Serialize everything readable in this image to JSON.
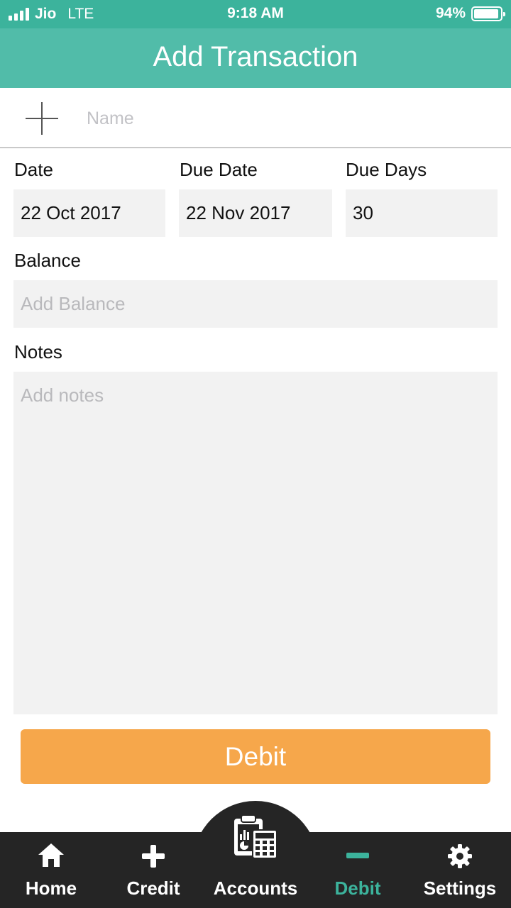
{
  "status_bar": {
    "carrier": "Jio",
    "network": "LTE",
    "time": "9:18 AM",
    "battery": "94%",
    "battery_level": 0.94
  },
  "header": {
    "title": "Add Transaction"
  },
  "name_row": {
    "icon": "plus-icon",
    "placeholder": "Name",
    "value": ""
  },
  "fields": {
    "date": {
      "label": "Date",
      "value": "22 Oct 2017"
    },
    "due_date": {
      "label": "Due Date",
      "value": "22 Nov 2017"
    },
    "due_days": {
      "label": "Due Days",
      "value": "30"
    },
    "balance": {
      "label": "Balance",
      "placeholder": "Add Balance",
      "value": ""
    },
    "notes": {
      "label": "Notes",
      "placeholder": "Add notes",
      "value": ""
    }
  },
  "action": {
    "debit_label": "Debit",
    "color": "#f6a74b"
  },
  "bottom_nav": {
    "items": [
      {
        "label": "Home",
        "icon": "home-icon"
      },
      {
        "label": "Credit",
        "icon": "plus-icon"
      },
      {
        "label": "Accounts",
        "icon": "accounts-icon"
      },
      {
        "label": "Debit",
        "icon": "minus-icon",
        "active": true
      },
      {
        "label": "Settings",
        "icon": "gear-icon"
      }
    ]
  },
  "colors": {
    "status_bar": "#3cb39c",
    "header": "#51bca9",
    "accent": "#3cb39c",
    "nav_background": "#252525",
    "field_background": "#f2f2f2"
  }
}
